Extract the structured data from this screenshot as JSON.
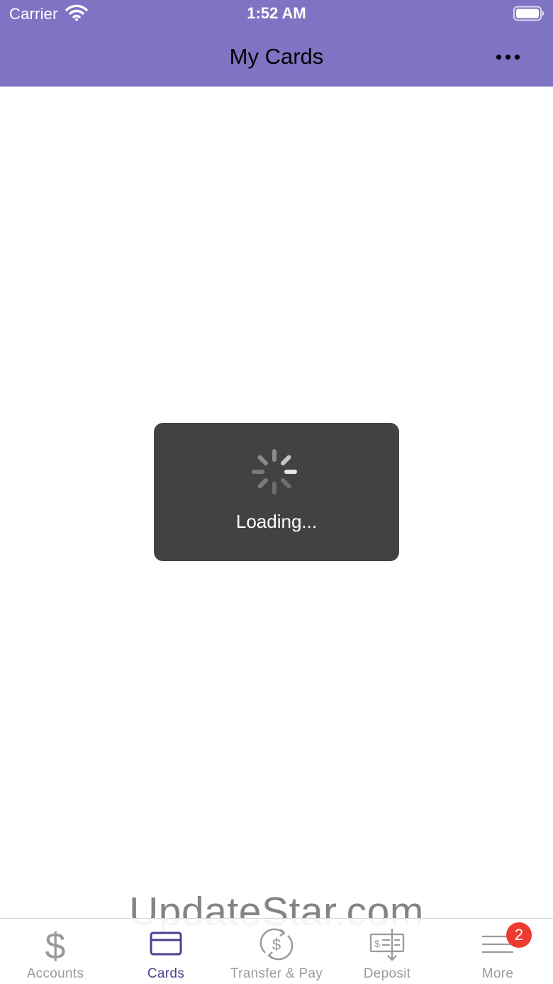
{
  "status_bar": {
    "carrier": "Carrier",
    "time": "1:52 AM"
  },
  "nav": {
    "title": "My Cards"
  },
  "loading": {
    "text": "Loading..."
  },
  "watermark": "UpdateStar.com",
  "tab_bar": {
    "items": [
      {
        "label": "Accounts",
        "icon": "dollar-icon",
        "active": false
      },
      {
        "label": "Cards",
        "icon": "credit-card-icon",
        "active": true
      },
      {
        "label": "Transfer & Pay",
        "icon": "transfer-icon",
        "active": false
      },
      {
        "label": "Deposit",
        "icon": "check-deposit-icon",
        "active": false
      },
      {
        "label": "More",
        "icon": "hamburger-menu-icon",
        "active": false,
        "badge": "2"
      }
    ]
  },
  "colors": {
    "header_bg": "#8173c3",
    "active_tab": "#4b3f8f",
    "inactive_tab": "#9a9a9a",
    "hud_bg": "#424242",
    "badge": "#ee3b31"
  }
}
